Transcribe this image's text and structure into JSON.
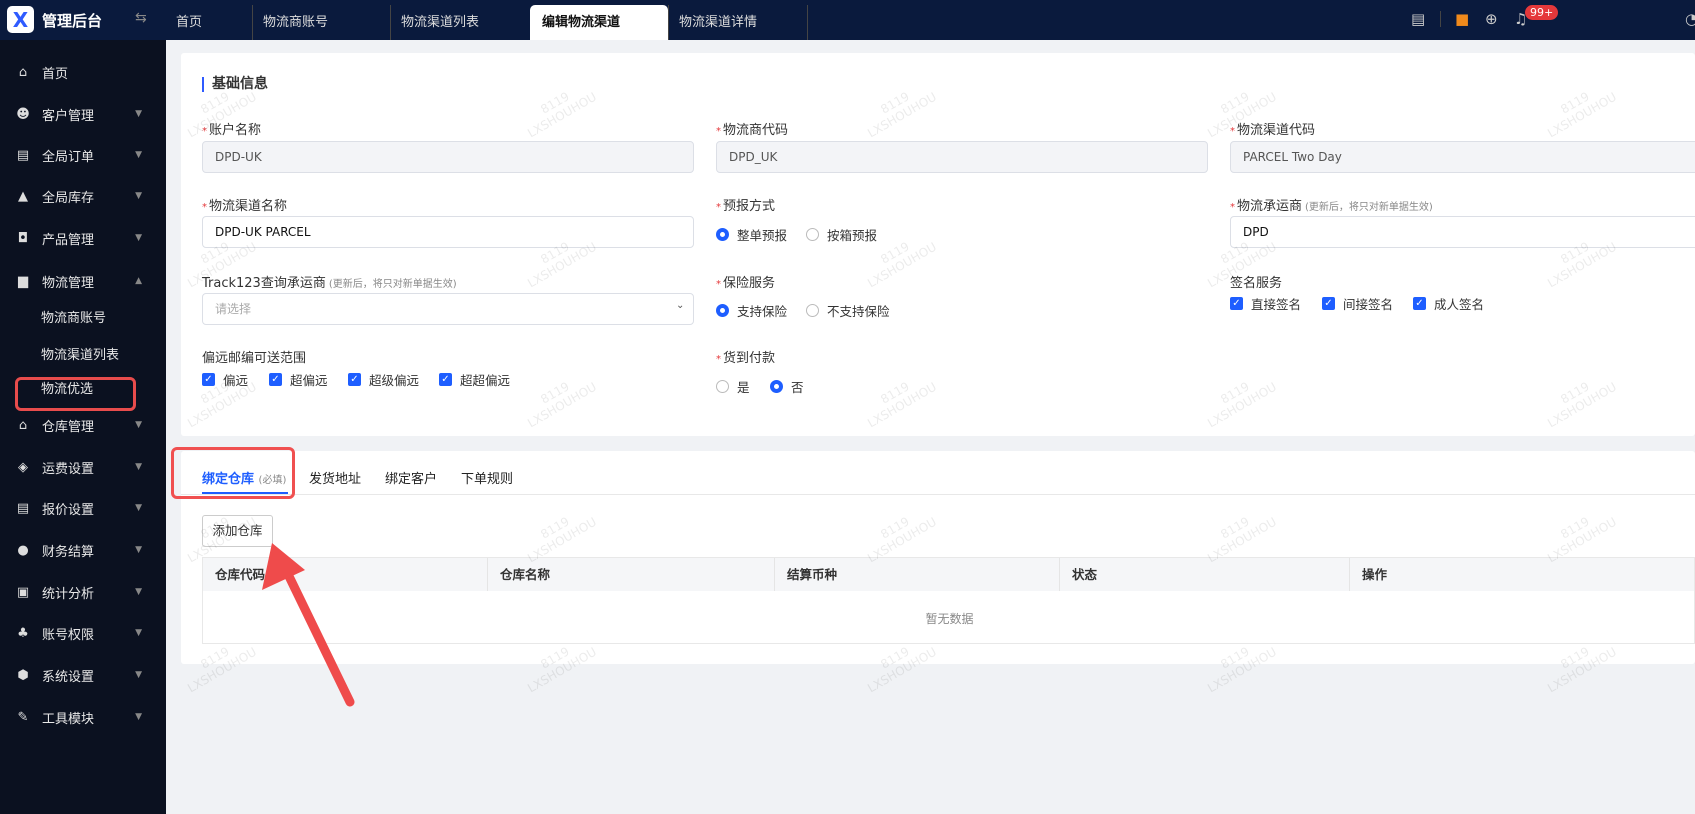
{
  "header": {
    "brand": "管理后台",
    "tabs": [
      "首页",
      "物流商账号",
      "物流渠道列表",
      "编辑物流渠道",
      "物流渠道详情"
    ],
    "active_tab": 3,
    "badge": "99+"
  },
  "sidebar": {
    "items": [
      {
        "label": "首页",
        "icon": "home-icon"
      },
      {
        "label": "客户管理",
        "icon": "users-icon"
      },
      {
        "label": "全局订单",
        "icon": "clipboard-icon"
      },
      {
        "label": "全局库存",
        "icon": "warehouse-icon"
      },
      {
        "label": "产品管理",
        "icon": "bag-icon"
      },
      {
        "label": "物流管理",
        "icon": "truck-icon"
      }
    ],
    "sub": [
      "物流商账号",
      "物流渠道列表",
      "物流优选"
    ],
    "items2": [
      {
        "label": "仓库管理",
        "icon": "warehouse-icon"
      },
      {
        "label": "运费设置",
        "icon": "box-icon"
      },
      {
        "label": "报价设置",
        "icon": "document-icon"
      },
      {
        "label": "财务结算",
        "icon": "money-icon"
      },
      {
        "label": "统计分析",
        "icon": "chart-icon"
      },
      {
        "label": "账号权限",
        "icon": "org-icon"
      },
      {
        "label": "系统设置",
        "icon": "settings-icon"
      },
      {
        "label": "工具模块",
        "icon": "wrench-icon"
      }
    ]
  },
  "form": {
    "section": "基础信息",
    "account_label": "账户名称",
    "account_value": "DPD-UK",
    "carrier_code_label": "物流商代码",
    "carrier_code_value": "DPD_UK",
    "channel_code_label": "物流渠道代码",
    "channel_code_value": "PARCEL Two Day",
    "channel_name_label": "物流渠道名称",
    "channel_name_value": "DPD-UK PARCEL",
    "forecast_label": "预报方式",
    "forecast_options": [
      "整单预报",
      "按箱预报"
    ],
    "shipper_label": "物流承运商",
    "shipper_hint": "(更新后，将只对新单据生效)",
    "shipper_value": "DPD",
    "track_label": "Track123查询承运商",
    "track_hint": "(更新后，将只对新单据生效)",
    "track_placeholder": "请选择",
    "insurance_label": "保险服务",
    "insurance_options": [
      "支持保险",
      "不支持保险"
    ],
    "sign_label": "签名服务",
    "sign_options": [
      "直接签名",
      "间接签名",
      "成人签名"
    ],
    "remote_label": "偏远邮编可送范围",
    "remote_options": [
      "偏远",
      "超偏远",
      "超级偏远",
      "超超偏远"
    ],
    "cod_label": "货到付款",
    "cod_options": [
      "是",
      "否"
    ]
  },
  "panel": {
    "tabs": [
      "绑定仓库",
      "发货地址",
      "绑定客户",
      "下单规则"
    ],
    "required_hint": "(必填)",
    "add_button": "添加仓库",
    "columns": [
      "仓库代码",
      "仓库名称",
      "结算币种",
      "状态",
      "操作"
    ],
    "empty": "暂无数据"
  },
  "watermark": [
    "8119",
    "LXSHOUHOU"
  ]
}
